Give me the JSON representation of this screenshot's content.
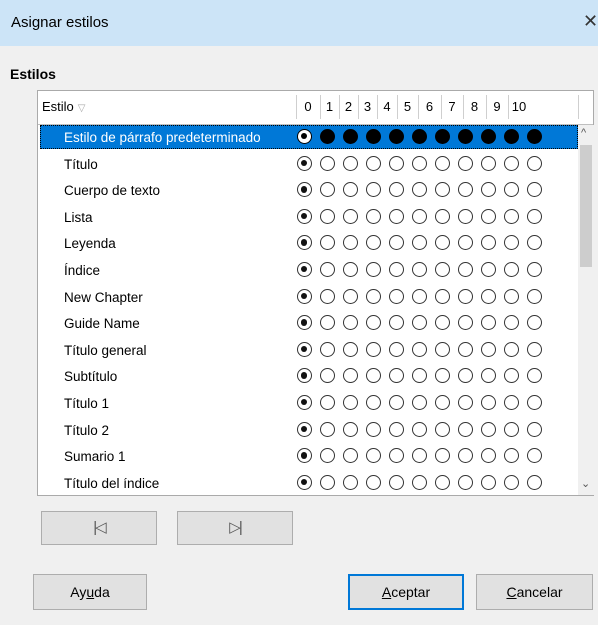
{
  "window": {
    "title": "Asignar estilos",
    "close_glyph": "✕"
  },
  "section": {
    "label": "Estilos"
  },
  "table": {
    "header": {
      "style_col": "Estilo",
      "sort_glyph": "▽",
      "levels": [
        "0",
        "1",
        "2",
        "3",
        "4",
        "5",
        "6",
        "7",
        "8",
        "9",
        "10"
      ]
    },
    "rows": [
      {
        "name": "Estilo de párrafo predeterminado",
        "level": 0,
        "selected": true
      },
      {
        "name": "Título",
        "level": 0,
        "selected": false
      },
      {
        "name": "Cuerpo de texto",
        "level": 0,
        "selected": false
      },
      {
        "name": "Lista",
        "level": 0,
        "selected": false
      },
      {
        "name": "Leyenda",
        "level": 0,
        "selected": false
      },
      {
        "name": "Índice",
        "level": 0,
        "selected": false
      },
      {
        "name": "New Chapter",
        "level": 0,
        "selected": false
      },
      {
        "name": "Guide Name",
        "level": 0,
        "selected": false
      },
      {
        "name": "Título general",
        "level": 0,
        "selected": false
      },
      {
        "name": "Subtítulo",
        "level": 0,
        "selected": false
      },
      {
        "name": "Título 1",
        "level": 0,
        "selected": false
      },
      {
        "name": "Título 2",
        "level": 0,
        "selected": false
      },
      {
        "name": "Sumario 1",
        "level": 0,
        "selected": false
      },
      {
        "name": "Título del índice",
        "level": 0,
        "selected": false
      }
    ]
  },
  "scrollbar": {
    "up_glyph": "^",
    "down_glyph": "⌄"
  },
  "nav": {
    "prev_glyph": "|◁",
    "next_glyph": "▷|"
  },
  "buttons": {
    "help": {
      "pre": "Ay",
      "mn": "u",
      "post": "da"
    },
    "ok": {
      "pre": "",
      "mn": "A",
      "post": "ceptar"
    },
    "cancel": {
      "pre": "",
      "mn": "C",
      "post": "ancelar"
    }
  },
  "colors": {
    "accent": "#0078d7",
    "titlebar": "#cce4f7"
  }
}
